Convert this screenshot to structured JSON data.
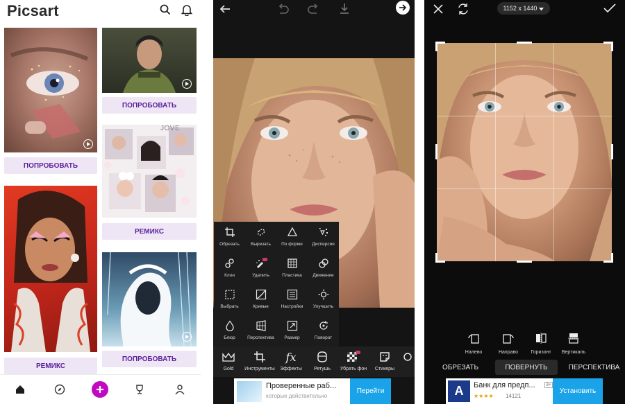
{
  "feed": {
    "logo": "Picsart",
    "cards": [
      {
        "button": "ПОПРОБОВАТЬ"
      },
      {
        "button": "ПОПРОБОВАТЬ"
      },
      {
        "button": "РЕМИКС"
      },
      {
        "button": "РЕМИКС"
      },
      {
        "button": "ПОПРОБОВАТЬ"
      }
    ],
    "collage_text": "JOVE",
    "nav": [
      "home-icon",
      "explore-icon",
      "create-button",
      "trophy-icon",
      "profile-icon"
    ],
    "accent": "#c209c1",
    "button_text_color": "#5b1f9c"
  },
  "editor": {
    "tools": [
      {
        "label": "Обрезать",
        "icon": "crop-icon"
      },
      {
        "label": "Вырезать",
        "icon": "cutout-icon"
      },
      {
        "label": "По форме",
        "icon": "shape-crop-icon"
      },
      {
        "label": "Дисперсия",
        "icon": "dispersion-icon"
      },
      {
        "label": "Клон",
        "icon": "clone-icon"
      },
      {
        "label": "Удалить",
        "icon": "remove-icon"
      },
      {
        "label": "Пластика",
        "icon": "stretch-icon"
      },
      {
        "label": "Движение",
        "icon": "motion-icon"
      },
      {
        "label": "Выбрать",
        "icon": "select-icon"
      },
      {
        "label": "Кривые",
        "icon": "curves-icon"
      },
      {
        "label": "Настройки",
        "icon": "adjust-icon"
      },
      {
        "label": "Улучшить",
        "icon": "enhance-icon"
      },
      {
        "label": "Блюр",
        "icon": "blur-icon"
      },
      {
        "label": "Перспектива",
        "icon": "perspective-icon"
      },
      {
        "label": "Размер",
        "icon": "resize-icon"
      },
      {
        "label": "Поворот",
        "icon": "rotate-icon"
      }
    ],
    "toolbar": [
      {
        "label": "Gold",
        "icon": "crown-icon"
      },
      {
        "label": "Инструменты",
        "icon": "crop-icon"
      },
      {
        "label": "Эффекты",
        "icon": "fx-icon"
      },
      {
        "label": "Ретушь",
        "icon": "retouch-icon"
      },
      {
        "label": "Убрать фон",
        "icon": "remove-bg-icon"
      },
      {
        "label": "Стикеры",
        "icon": "sticker-icon"
      }
    ],
    "ad": {
      "title": "Проверенные раб...",
      "subtitle": "которые действительно",
      "button": "Перейти"
    }
  },
  "crop": {
    "size": "1152 x 1440",
    "controls": [
      {
        "label": "Налево",
        "icon": "rotate-left-icon"
      },
      {
        "label": "Направо",
        "icon": "rotate-right-icon"
      },
      {
        "label": "Горизонт",
        "icon": "flip-horizontal-icon"
      },
      {
        "label": "Вертикаль",
        "icon": "flip-vertical-icon"
      }
    ],
    "tabs": [
      "ОБРЕЗАТЬ",
      "ПОВЕРНУТЬ",
      "ПЕРСПЕКТИВА"
    ],
    "ad": {
      "logo": "A",
      "title": "Банк для предп...",
      "badge": "3+",
      "stars": "★★★★",
      "rating_count": "14121",
      "button": "Установить"
    }
  }
}
